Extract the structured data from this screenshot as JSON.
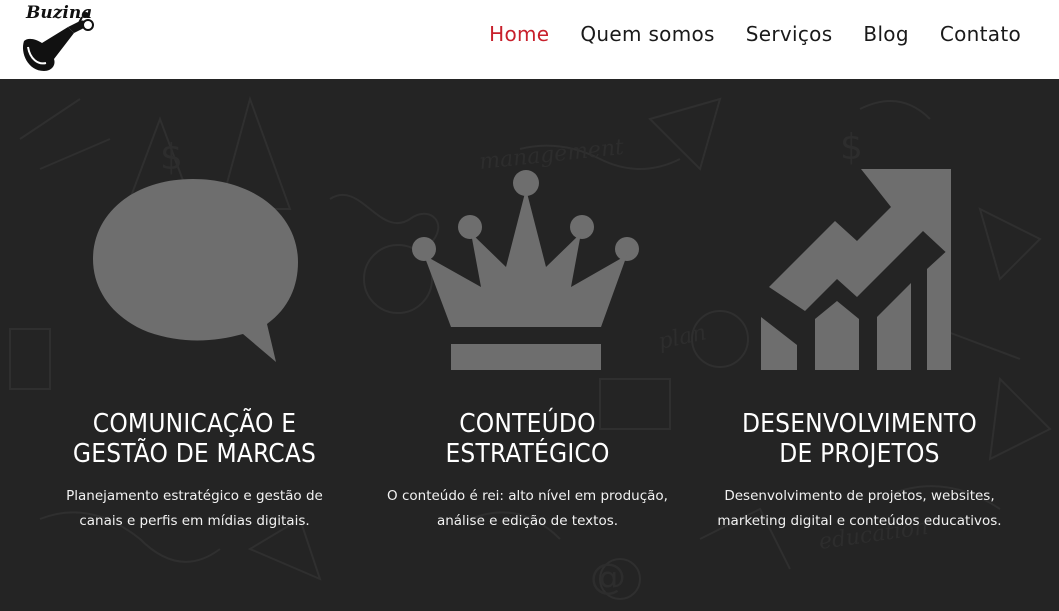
{
  "brand": {
    "logo_text": "Buzina"
  },
  "nav": {
    "items": [
      {
        "label": "Home",
        "active": true
      },
      {
        "label": "Quem somos",
        "active": false
      },
      {
        "label": "Serviços",
        "active": false
      },
      {
        "label": "Blog",
        "active": false
      },
      {
        "label": "Contato",
        "active": false
      }
    ]
  },
  "colors": {
    "accent": "#c8202c",
    "icon_gray": "#6e6e6e",
    "background": "#242424"
  },
  "features": [
    {
      "icon": "speech-bubble-icon",
      "title": "COMUNICAÇÃO E\nGESTÃO DE MARCAS",
      "description": "Planejamento estratégico e gestão de\ncanais e perfis em mídias digitais."
    },
    {
      "icon": "crown-icon",
      "title": "CONTEÚDO\nESTRATÉGICO",
      "description": "O conteúdo é rei: alto nível em produção,\nanálise e edição de textos."
    },
    {
      "icon": "growth-chart-icon",
      "title": "DESENVOLVIMENTO\nDE PROJETOS",
      "description": "Desenvolvimento de projetos, websites,\nmarketing digital e conteúdos educativos."
    }
  ]
}
